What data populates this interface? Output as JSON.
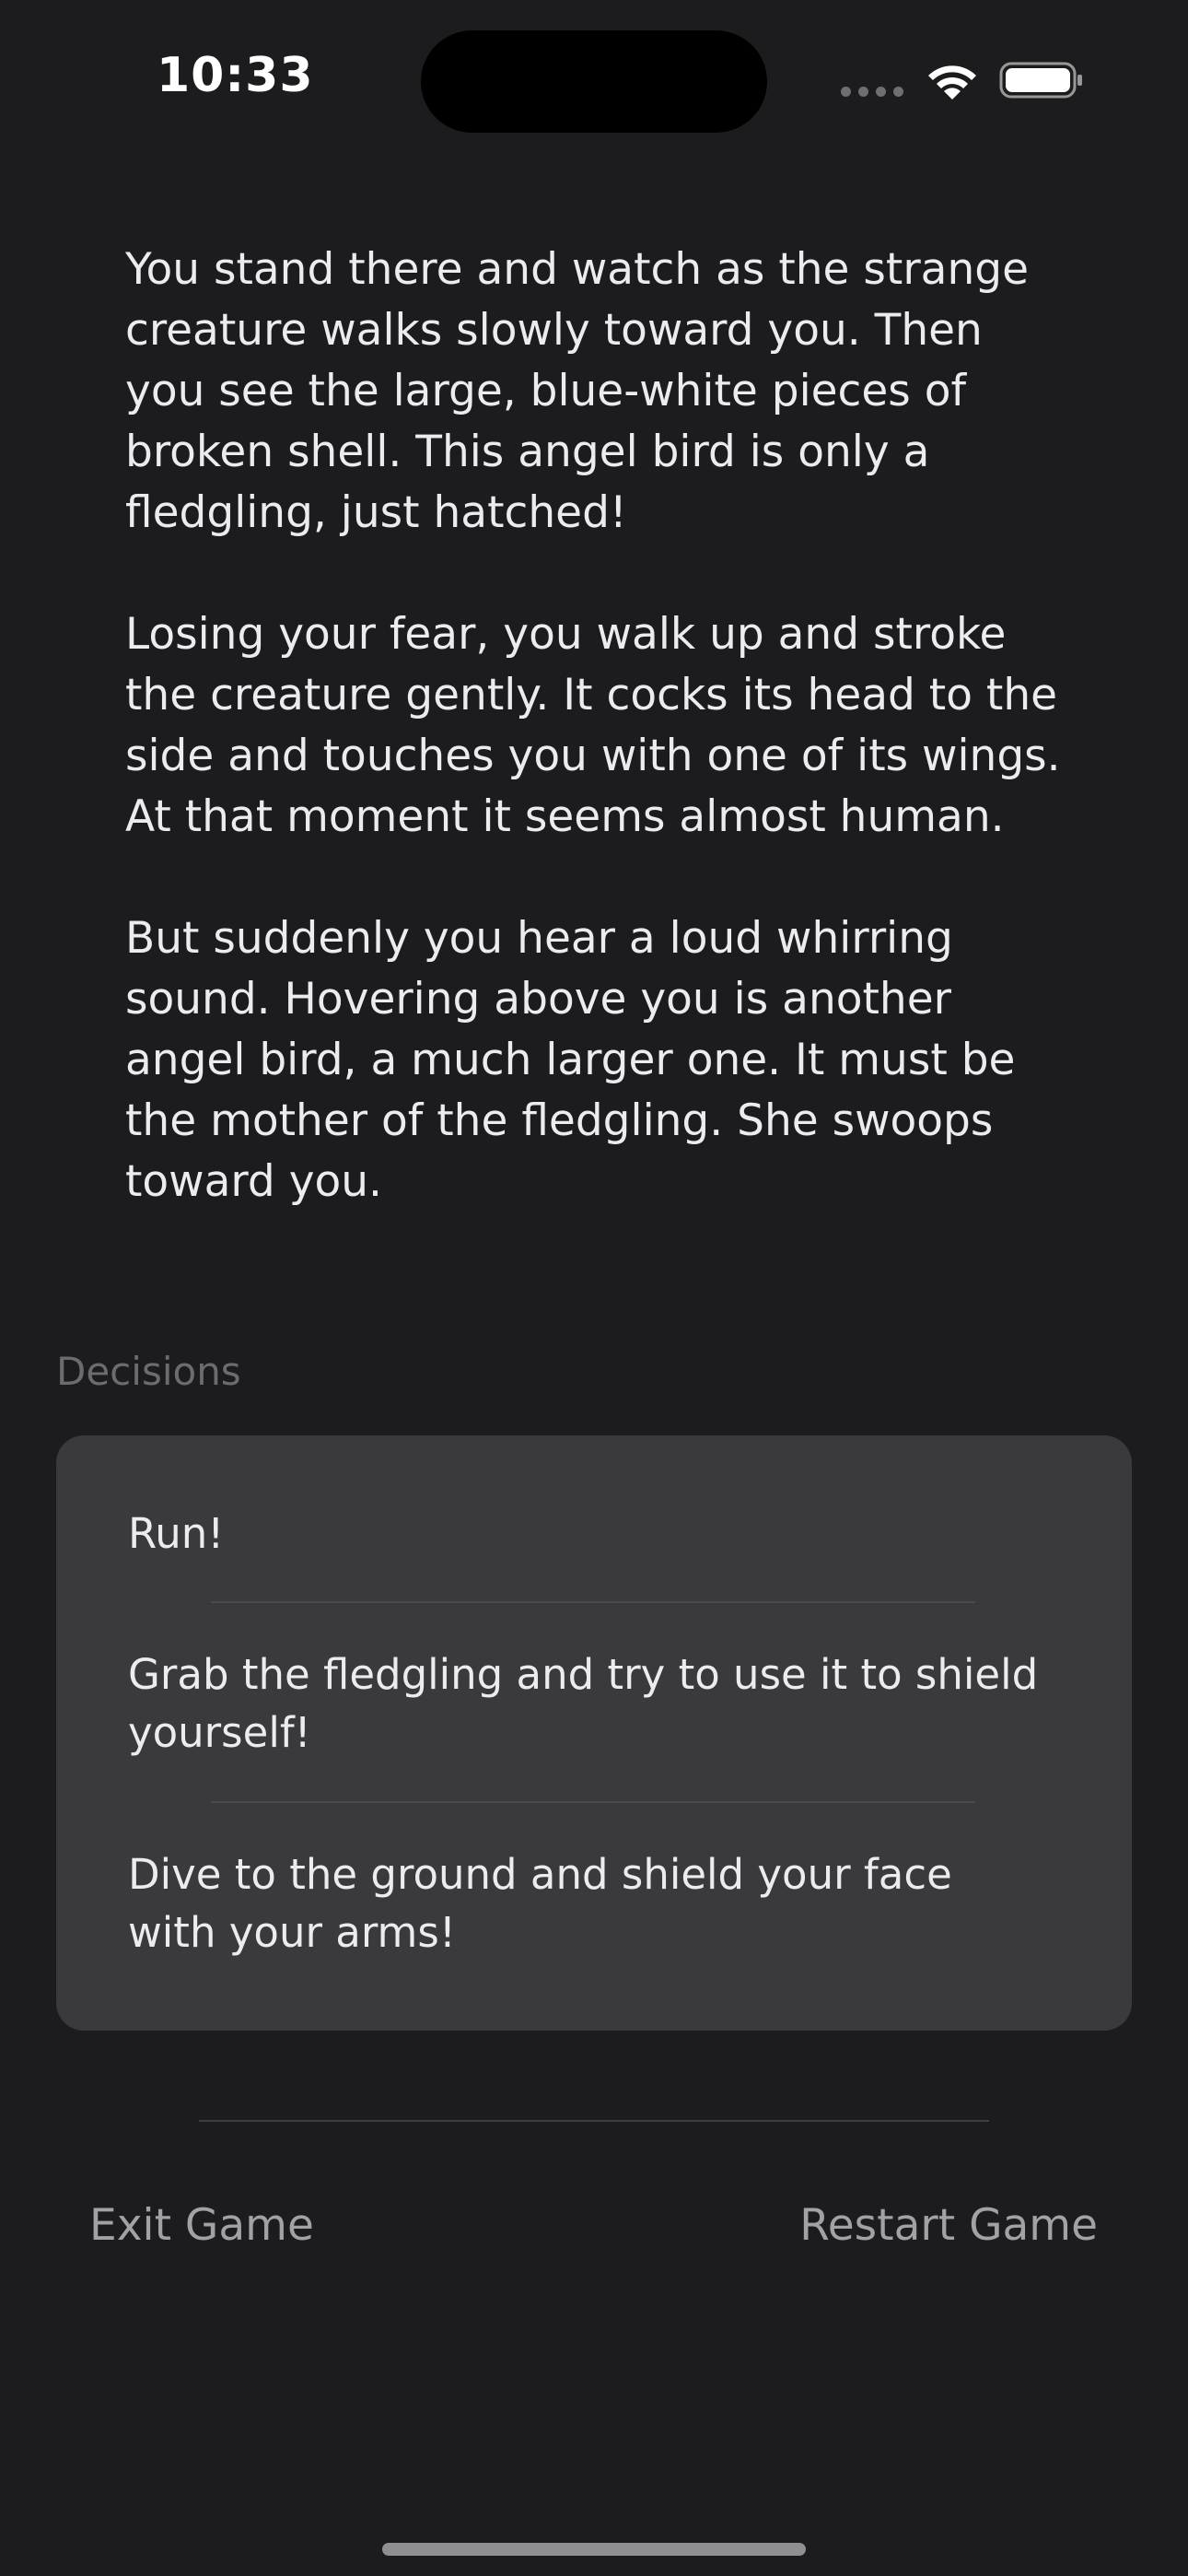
{
  "status_bar": {
    "time": "10:33",
    "icons": [
      "cellular-signal-icon",
      "wifi-icon",
      "battery-icon"
    ]
  },
  "story": {
    "paragraphs": [
      "You stand there and watch as the strange creature walks slowly toward you. Then you see the large, blue-white pieces of broken shell. This angel bird is only a fledgling, just hatched!",
      "Losing your fear, you walk up and stroke the creature gently. It cocks its head to the side and touches you with one of its wings. At that moment it seems almost human.",
      "But suddenly you hear a loud whirring sound. Hovering above you is another angel bird, a much larger one. It must be the mother of the fledgling. She swoops toward you."
    ]
  },
  "decisions": {
    "label": "Decisions",
    "options": [
      "Run!",
      "Grab the fledgling and try to use it to shield yourself!",
      "Dive to the ground and shield your face with your arms!"
    ]
  },
  "footer": {
    "exit_label": "Exit Game",
    "restart_label": "Restart Game"
  },
  "colors": {
    "background": "#1c1c1e",
    "card": "#3a3a3c",
    "text": "#ebebf0",
    "secondary_text": "#a1a1a6"
  }
}
